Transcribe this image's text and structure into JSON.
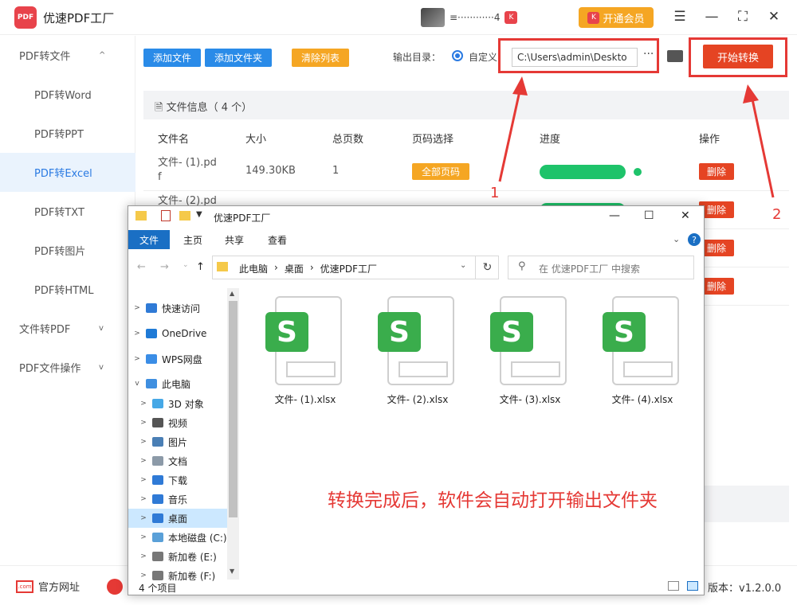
{
  "app": {
    "title": "优速PDF工厂",
    "logo_text": "PDF",
    "user_name": "≡············4",
    "vip_label": "开通会员"
  },
  "sidebar": [
    {
      "label": "PDF转文件",
      "level": "top",
      "chev": "^"
    },
    {
      "label": "PDF转Word",
      "level": "sub"
    },
    {
      "label": "PDF转PPT",
      "level": "sub"
    },
    {
      "label": "PDF转Excel",
      "level": "sub",
      "active": true
    },
    {
      "label": "PDF转TXT",
      "level": "sub"
    },
    {
      "label": "PDF转图片",
      "level": "sub"
    },
    {
      "label": "PDF转HTML",
      "level": "sub"
    },
    {
      "label": "文件转PDF",
      "level": "top",
      "chev": "v"
    },
    {
      "label": "PDF文件操作",
      "level": "top",
      "chev": "v"
    }
  ],
  "toolbar": {
    "add_file": "添加文件",
    "add_folder": "添加文件夹",
    "clear_list": "清除列表",
    "output_label": "输出目录：",
    "custom_label": "自定义",
    "output_path": "C:\\Users\\admin\\Deskto",
    "more": "···",
    "start": "开始转换"
  },
  "panel": {
    "title": "文件信息（ 4 个）",
    "columns": [
      "文件名",
      "大小",
      "总页数",
      "页码选择",
      "进度",
      "操作"
    ],
    "rows": [
      {
        "name": "文件- (1).pd\nf",
        "size": "149.30KB",
        "pages": "1",
        "page_btn": "全部页码",
        "progress": 1.0,
        "del": "删除"
      },
      {
        "name": "文件- (2).pd",
        "size": "",
        "pages": "",
        "page_btn": "",
        "progress": 1.0,
        "del": "删除"
      },
      {
        "name": "",
        "size": "",
        "pages": "",
        "page_btn": "",
        "progress": null,
        "del": "删除"
      },
      {
        "name": "",
        "size": "",
        "pages": "",
        "page_btn": "",
        "progress": null,
        "del": "删除"
      }
    ],
    "annotation_1": "1",
    "annotation_2": "2"
  },
  "footer": {
    "site": "官方网址",
    "site_icon": ".com",
    "version": "版本：v1.2.0.0"
  },
  "explorer": {
    "title": "优速PDF工厂",
    "ribbon": [
      "文件",
      "主页",
      "共享",
      "查看"
    ],
    "help": "?",
    "crumbs": [
      "此电脑",
      "›",
      "桌面",
      "›",
      "优速PDF工厂"
    ],
    "search_placeholder": "在 优速PDF工厂 中搜索",
    "nav": [
      {
        "label": "快速访问",
        "color": "#2f7ad6",
        "exp": ">"
      },
      {
        "label": "OneDrive",
        "color": "#1f7ad6",
        "exp": ">"
      },
      {
        "label": "WPS网盘",
        "color": "#3a8de6",
        "exp": ">"
      },
      {
        "label": "此电脑",
        "color": "#3f8fe0",
        "exp": "v"
      },
      {
        "label": "3D 对象",
        "color": "#46a8e6",
        "exp": ">",
        "indent": true
      },
      {
        "label": "视频",
        "color": "#555555",
        "exp": ">",
        "indent": true
      },
      {
        "label": "图片",
        "color": "#4a7fb5",
        "exp": ">",
        "indent": true
      },
      {
        "label": "文档",
        "color": "#8c9aa8",
        "exp": ">",
        "indent": true
      },
      {
        "label": "下载",
        "color": "#2f7ad6",
        "exp": ">",
        "indent": true
      },
      {
        "label": "音乐",
        "color": "#2f7ad6",
        "exp": ">",
        "indent": true
      },
      {
        "label": "桌面",
        "color": "#2f7ad6",
        "exp": ">",
        "indent": true,
        "selected": true
      },
      {
        "label": "本地磁盘 (C:)",
        "color": "#5aa0d8",
        "exp": ">",
        "indent": true
      },
      {
        "label": "新加卷 (E:)",
        "color": "#777777",
        "exp": ">",
        "indent": true
      },
      {
        "label": "新加卷 (F:)",
        "color": "#777777",
        "exp": ">",
        "indent": true
      }
    ],
    "files": [
      {
        "name": "文件- (1).xlsx",
        "tag": "S"
      },
      {
        "name": "文件- (2).xlsx",
        "tag": "S"
      },
      {
        "name": "文件- (3).xlsx",
        "tag": "S"
      },
      {
        "name": "文件- (4).xlsx",
        "tag": "S"
      }
    ],
    "message": "转换完成后，软件会自动打开输出文件夹",
    "status": "4 个项目"
  }
}
